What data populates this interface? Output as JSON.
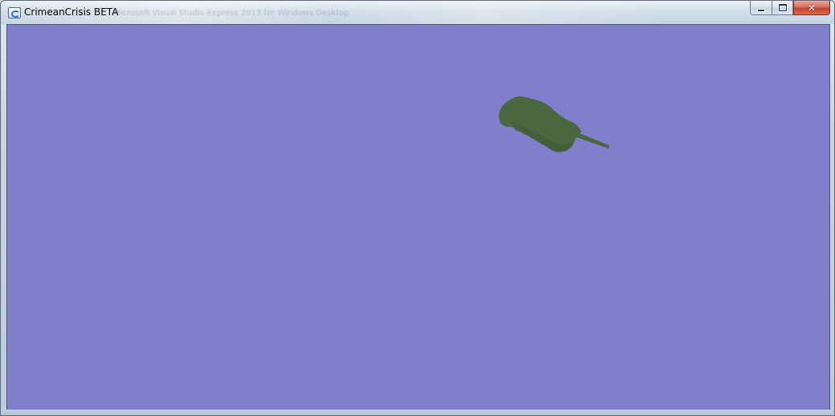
{
  "window": {
    "title": "CrimeanCrisis BETA",
    "icon": "app-window-icon",
    "background_title": "Microsoft Visual Studio Express 2013 for Windows Desktop",
    "controls": {
      "minimize_icon": "minimize-icon",
      "maximize_icon": "maximize-icon",
      "close_icon": "close-icon",
      "close_glyph": "✕"
    }
  },
  "scene": {
    "background_color": "#807fcc",
    "tank": {
      "color": "#4b673f",
      "shade_color": "#3e5735"
    }
  }
}
